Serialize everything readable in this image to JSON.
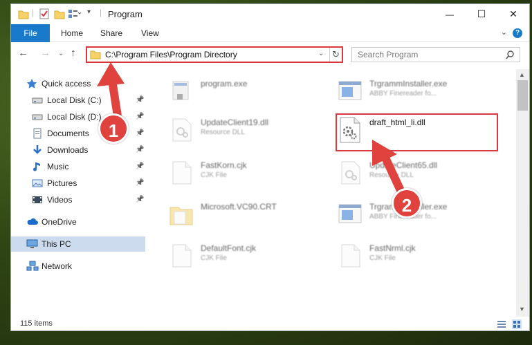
{
  "window": {
    "title": "Program",
    "minimize": "—",
    "maximize": "☐",
    "close": "✕"
  },
  "ribbon": {
    "tabs": [
      "File",
      "Home",
      "Share",
      "View"
    ],
    "help": "?"
  },
  "nav": {
    "address": "C:\\Program Files\\Program Directory",
    "search_placeholder": "Search Program"
  },
  "sidebar": {
    "items": [
      {
        "label": "Quick access",
        "icon": "star-icon",
        "pinned": false
      },
      {
        "label": "Local Disk (C:)",
        "icon": "drive-icon",
        "pinned": true
      },
      {
        "label": "Local Disk (D:)",
        "icon": "drive-icon",
        "pinned": true
      },
      {
        "label": "Documents",
        "icon": "documents-icon",
        "pinned": true
      },
      {
        "label": "Downloads",
        "icon": "download-icon",
        "pinned": true
      },
      {
        "label": "Music",
        "icon": "music-icon",
        "pinned": true
      },
      {
        "label": "Pictures",
        "icon": "pictures-icon",
        "pinned": true
      },
      {
        "label": "Videos",
        "icon": "videos-icon",
        "pinned": true
      },
      {
        "label": "OneDrive",
        "icon": "cloud-icon",
        "pinned": false
      },
      {
        "label": "This PC",
        "icon": "computer-icon",
        "pinned": false,
        "selected": true
      },
      {
        "label": "Network",
        "icon": "network-icon",
        "pinned": false
      }
    ]
  },
  "files": [
    {
      "name": "program.exe",
      "type": "",
      "icon": "exe-icon"
    },
    {
      "name": "TrgrammInstaller.exe",
      "type": "ABBY Finereader fo...",
      "icon": "installer-icon"
    },
    {
      "name": "UpdateClient19.dll",
      "type": "Resource DLL",
      "icon": "dll-icon"
    },
    {
      "name": "draft_html_li.dll",
      "type": "",
      "icon": "dll-gear-icon"
    },
    {
      "name": "FastKorn.cjk",
      "type": "CJK File",
      "icon": "file-icon"
    },
    {
      "name": "UpdateClient65.dll",
      "type": "Resource DLL",
      "icon": "dll-icon"
    },
    {
      "name": "Microsoft.VC90.CRT",
      "type": "",
      "icon": "folder-icon"
    },
    {
      "name": "TrgrammInstaller.exe",
      "type": "ABBY Finereader fo...",
      "icon": "installer-icon"
    },
    {
      "name": "DefaultFont.cjk",
      "type": "CJK File",
      "icon": "file-icon"
    },
    {
      "name": "FastNrml.cjk",
      "type": "CJK File",
      "icon": "file-icon"
    }
  ],
  "status": {
    "item_count": "115 items"
  },
  "annotations": {
    "step1": "1",
    "step2": "2",
    "color": "#e0423d"
  }
}
